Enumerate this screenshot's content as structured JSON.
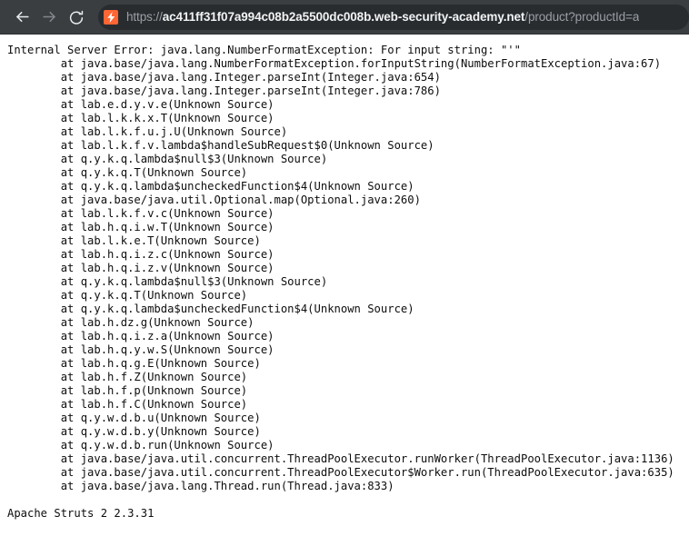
{
  "browser": {
    "back_button": "Back",
    "forward_button": "Forward",
    "reload_button": "Reload this page",
    "favicon_name": "lightning-bolt-favicon",
    "accent_color": "#ff6633",
    "toolbar_color": "#3b3e41",
    "omnibox_color": "#292c2f",
    "url": {
      "scheme": "https://",
      "host": "ac411ff31f07a994c08b2a5500dc008b.web-security-academy.net",
      "path": "/product?productId=a",
      "full": "https://ac411ff31f07a994c08b2a5500dc008b.web-security-academy.net/product?productId=a"
    }
  },
  "page": {
    "error_headline": "Internal Server Error: java.lang.NumberFormatException: For input string: \"'\"",
    "stack_trace": [
      "        at java.base/java.lang.NumberFormatException.forInputString(NumberFormatException.java:67)",
      "        at java.base/java.lang.Integer.parseInt(Integer.java:654)",
      "        at java.base/java.lang.Integer.parseInt(Integer.java:786)",
      "        at lab.e.d.y.v.e(Unknown Source)",
      "        at lab.l.k.k.x.T(Unknown Source)",
      "        at lab.l.k.f.u.j.U(Unknown Source)",
      "        at lab.l.k.f.v.lambda$handleSubRequest$0(Unknown Source)",
      "        at q.y.k.q.lambda$null$3(Unknown Source)",
      "        at q.y.k.q.T(Unknown Source)",
      "        at q.y.k.q.lambda$uncheckedFunction$4(Unknown Source)",
      "        at java.base/java.util.Optional.map(Optional.java:260)",
      "        at lab.l.k.f.v.c(Unknown Source)",
      "        at lab.h.q.i.w.T(Unknown Source)",
      "        at lab.l.k.e.T(Unknown Source)",
      "        at lab.h.q.i.z.c(Unknown Source)",
      "        at lab.h.q.i.z.v(Unknown Source)",
      "        at q.y.k.q.lambda$null$3(Unknown Source)",
      "        at q.y.k.q.T(Unknown Source)",
      "        at q.y.k.q.lambda$uncheckedFunction$4(Unknown Source)",
      "        at lab.h.dz.g(Unknown Source)",
      "        at lab.h.q.i.z.a(Unknown Source)",
      "        at lab.h.q.y.w.S(Unknown Source)",
      "        at lab.h.q.g.E(Unknown Source)",
      "        at lab.h.f.Z(Unknown Source)",
      "        at lab.h.f.p(Unknown Source)",
      "        at lab.h.f.C(Unknown Source)",
      "        at q.y.w.d.b.u(Unknown Source)",
      "        at q.y.w.d.b.y(Unknown Source)",
      "        at q.y.w.d.b.run(Unknown Source)",
      "        at java.base/java.util.concurrent.ThreadPoolExecutor.runWorker(ThreadPoolExecutor.java:1136)",
      "        at java.base/java.util.concurrent.ThreadPoolExecutor$Worker.run(ThreadPoolExecutor.java:635)",
      "        at java.base/java.lang.Thread.run(Thread.java:833)"
    ],
    "footer": "Apache Struts 2 2.3.31"
  }
}
